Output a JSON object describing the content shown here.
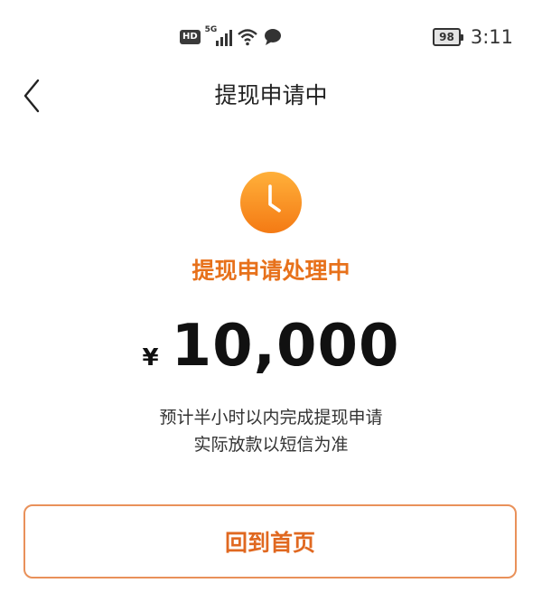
{
  "status_bar": {
    "hd_label": "HD",
    "network_label": "5G",
    "battery_level": "98",
    "time": "3:11",
    "icons": [
      "hd-badge",
      "signal-icon",
      "wifi-icon",
      "message-icon",
      "battery-icon"
    ]
  },
  "nav": {
    "back_icon": "chevron-left-icon",
    "title": "提现申请中"
  },
  "status": {
    "icon": "clock-icon",
    "title": "提现申请处理中"
  },
  "amount": {
    "currency": "¥",
    "value": "10,000"
  },
  "notes": {
    "line1": "预计半小时以内完成提现申请",
    "line2": "实际放款以短信为准"
  },
  "actions": {
    "home_label": "回到首页"
  },
  "colors": {
    "accent": "#e7711b",
    "clock_gradient_top": "#ffb03a",
    "clock_gradient_bottom": "#f47a14",
    "button_border": "#e9915a"
  }
}
